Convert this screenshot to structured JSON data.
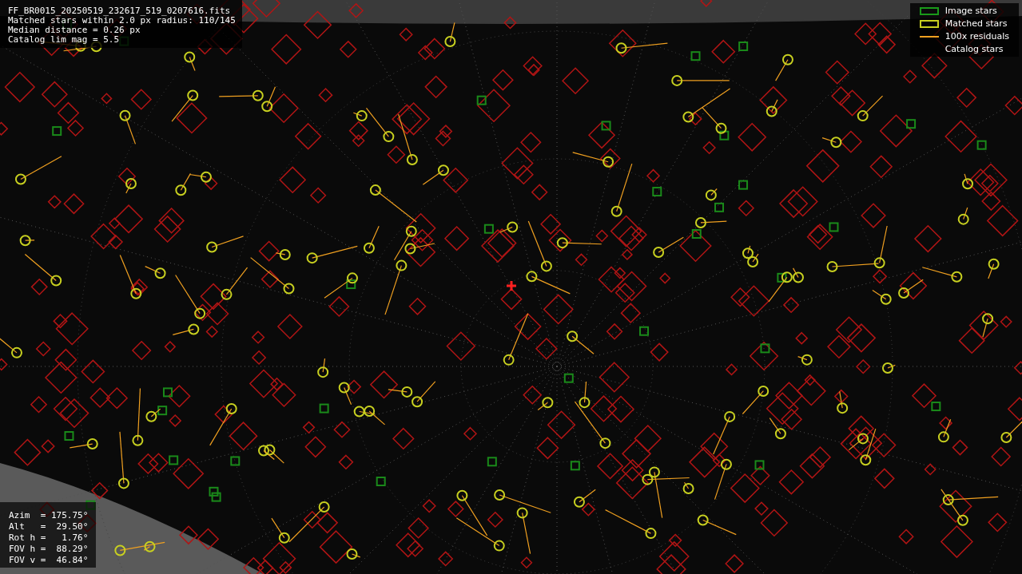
{
  "info": {
    "lines": [
      "FF_BR0015_20250519_232617_519_0207616.fits",
      "Matched stars within 2.0 px radius: 110/145",
      "Median distance = 0.26 px",
      "Catalog lim mag = 5.5"
    ]
  },
  "legend": [
    {
      "kind": "image",
      "label": "Image stars"
    },
    {
      "kind": "matched",
      "label": "Matched stars"
    },
    {
      "kind": "residual",
      "label": "100x residuals"
    },
    {
      "kind": "catalog",
      "label": "Catalog stars"
    }
  ],
  "pointing": [
    "Azim  = 175.75°",
    "Alt   =  29.50°",
    "Rot h =   1.76°",
    "FOV h =  88.29°",
    "FOV v =  46.84°"
  ]
}
